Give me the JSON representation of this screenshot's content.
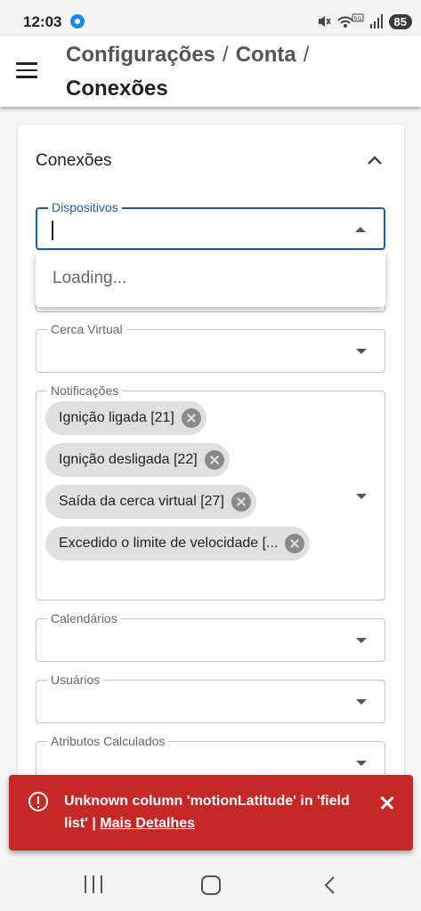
{
  "status_bar": {
    "time": "12:03",
    "battery": "85",
    "icons": [
      "location-icon",
      "mute-icon",
      "wifi-5g-icon",
      "signal-icon",
      "battery-icon"
    ]
  },
  "app_bar": {
    "breadcrumb": [
      "Configurações",
      "Conta"
    ],
    "separator": "/",
    "current": "Conexões"
  },
  "card": {
    "title": "Conexões",
    "fields": {
      "dispositivos": {
        "label": "Dispositivos",
        "value": "",
        "focused": true
      },
      "cerca_virtual": {
        "label": "Cerca Virtual",
        "value": ""
      },
      "notificacoes": {
        "label": "Notificações",
        "chips": [
          "Ignição ligada [21]",
          "Ignição desligada [22]",
          "Saída da cerca virtual [27]",
          "Excedido o limite de velocidade [..."
        ]
      },
      "calendarios": {
        "label": "Calendários",
        "value": ""
      },
      "usuarios": {
        "label": "Usuários",
        "value": ""
      },
      "atributos": {
        "label": "Atributos Calculados",
        "value": ""
      }
    },
    "popup": {
      "text": "Loading..."
    }
  },
  "snackbar": {
    "message": "Unknown column 'motionLatitude' in 'field list' |",
    "link": "Mais Detalhes",
    "color": "#c62828"
  },
  "colors": {
    "accent": "#1d5fa8",
    "error": "#c62828"
  }
}
